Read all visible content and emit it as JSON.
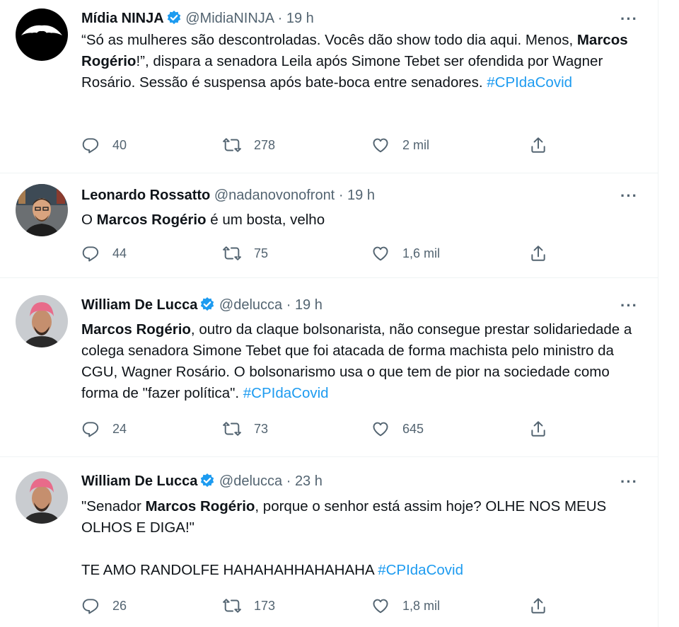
{
  "tweets": [
    {
      "name": "Mídia NINJA",
      "verified": true,
      "handle": "@MidiaNINJA",
      "time": "19 h",
      "body_parts": [
        {
          "t": "“Só as mulheres são descontroladas. Vocês dão show todo dia aqui. Menos, "
        },
        {
          "t": "Marcos Rogério",
          "bold": true
        },
        {
          "t": "!”, dispara a senadora Leila após Simone Tebet ser ofendida por Wagner Rosário. Sessão é suspensa após bate-boca entre senadores. "
        },
        {
          "t": "#CPIdaCovid",
          "tag": true
        }
      ],
      "replies": "40",
      "retweets": "278",
      "likes": "2 mil"
    },
    {
      "name": "Leonardo Rossatto",
      "verified": false,
      "handle": "@nadanovonofront",
      "time": "19 h",
      "body_parts": [
        {
          "t": "O "
        },
        {
          "t": "Marcos Rogério",
          "bold": true
        },
        {
          "t": " é um bosta, velho"
        }
      ],
      "replies": "44",
      "retweets": "75",
      "likes": "1,6 mil"
    },
    {
      "name": "William De Lucca",
      "verified": true,
      "handle": "@delucca",
      "time": "19 h",
      "body_parts": [
        {
          "t": "Marcos Rogério",
          "bold": true
        },
        {
          "t": ", outro da claque bolsonarista, não consegue prestar solidariedade a colega senadora Simone Tebet que foi atacada de forma machista pelo ministro da CGU, Wagner Rosário. O bolsonarismo usa o que tem de pior na sociedade como forma de \"fazer política\". "
        },
        {
          "t": "#CPIdaCovid",
          "tag": true
        }
      ],
      "replies": "24",
      "retweets": "73",
      "likes": "645"
    },
    {
      "name": "William De Lucca",
      "verified": true,
      "handle": "@delucca",
      "time": "23 h",
      "body_parts": [
        {
          "t": "\"Senador "
        },
        {
          "t": "Marcos Rogério",
          "bold": true
        },
        {
          "t": ", porque o senhor está assim hoje? OLHE NOS MEUS OLHOS E DIGA!\"\n\nTE AMO RANDOLFE HAHAHAHHAHAHAHA "
        },
        {
          "t": "#CPIdaCovid",
          "tag": true
        }
      ],
      "replies": "26",
      "retweets": "173",
      "likes": "1,8 mil"
    }
  ],
  "ui": {
    "dot": "·",
    "more_label": "···"
  },
  "icons": {
    "reply": "reply-icon",
    "retweet": "retweet-icon",
    "like": "like-icon",
    "share": "share-icon",
    "verified": "verified-badge-icon",
    "more": "more-options-icon"
  },
  "colors": {
    "link": "#1d9bf0",
    "secondary": "#536471",
    "verified": "#1d9bf0"
  }
}
